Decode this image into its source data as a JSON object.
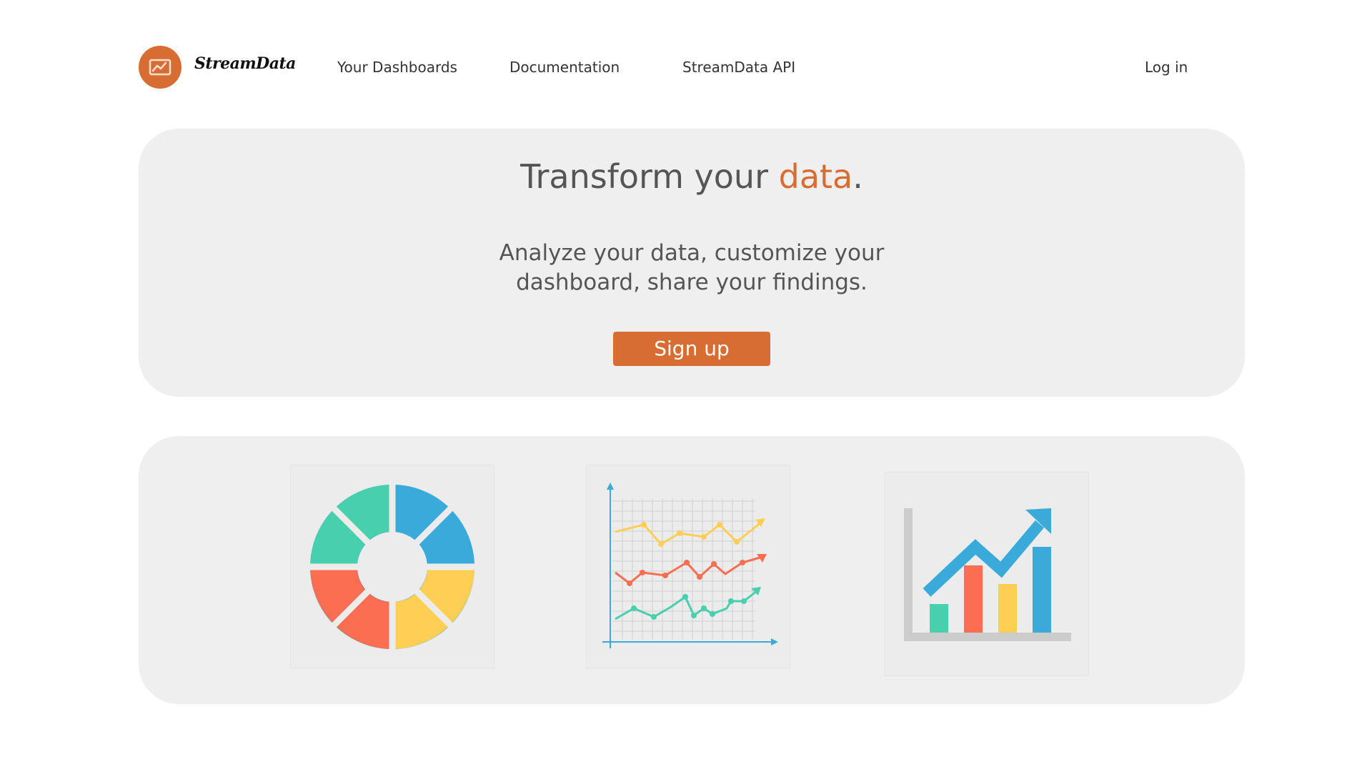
{
  "header": {
    "brand": "StreamData",
    "nav": {
      "dashboards": "Your Dashboards",
      "documentation": "Documentation",
      "api": "StreamData API"
    },
    "login": "Log in"
  },
  "hero": {
    "title_prefix": "Transform your ",
    "title_accent": "data",
    "title_suffix": ".",
    "subtitle": "Analyze your data, customize your dashboard, share your findings.",
    "signup": "Sign up"
  },
  "colors": {
    "accent": "#d86d33",
    "card_bg": "#efefef",
    "teal": "#48cfad",
    "blue": "#3aaadb",
    "yellow": "#ffce54",
    "red": "#fc6e51"
  },
  "icons": [
    "chart-logo-icon",
    "donut-chart-icon",
    "line-chart-icon",
    "growth-bar-chart-icon"
  ]
}
